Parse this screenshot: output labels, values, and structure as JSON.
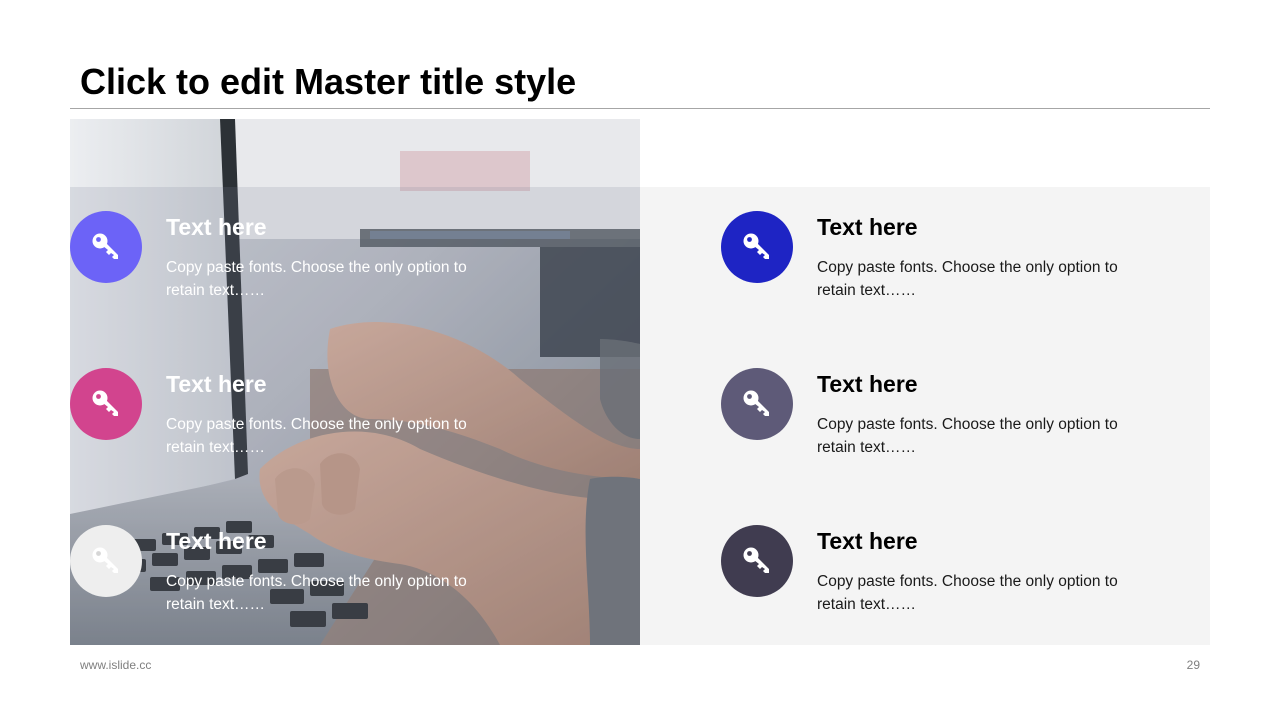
{
  "slide": {
    "title": "Click to edit Master title style",
    "footer_url": "www.islide.cc",
    "page_number": "29"
  },
  "left_items": [
    {
      "title": "Text here",
      "desc": "Copy paste fonts. Choose the only option to retain text……",
      "color": "#6c63f7",
      "icon": "key-icon"
    },
    {
      "title": "Text here",
      "desc": "Copy paste fonts. Choose the only option to retain text……",
      "color": "#d2448e",
      "icon": "key-icon"
    },
    {
      "title": "Text here",
      "desc": "Copy paste fonts. Choose the only option to retain text……",
      "color": "#eeeeee",
      "icon": "key-icon"
    }
  ],
  "right_items": [
    {
      "title": "Text here",
      "desc": "Copy paste fonts. Choose the only option to retain text……",
      "color": "#1e24c4",
      "icon": "key-icon"
    },
    {
      "title": "Text here",
      "desc": "Copy paste fonts. Choose the only option to retain text……",
      "color": "#5e5a78",
      "icon": "key-icon"
    },
    {
      "title": "Text here",
      "desc": "Copy paste fonts. Choose the only option to retain text……",
      "color": "#403c50",
      "icon": "key-icon"
    }
  ],
  "photo": {
    "subject": "hands typing on laptop keyboard"
  }
}
